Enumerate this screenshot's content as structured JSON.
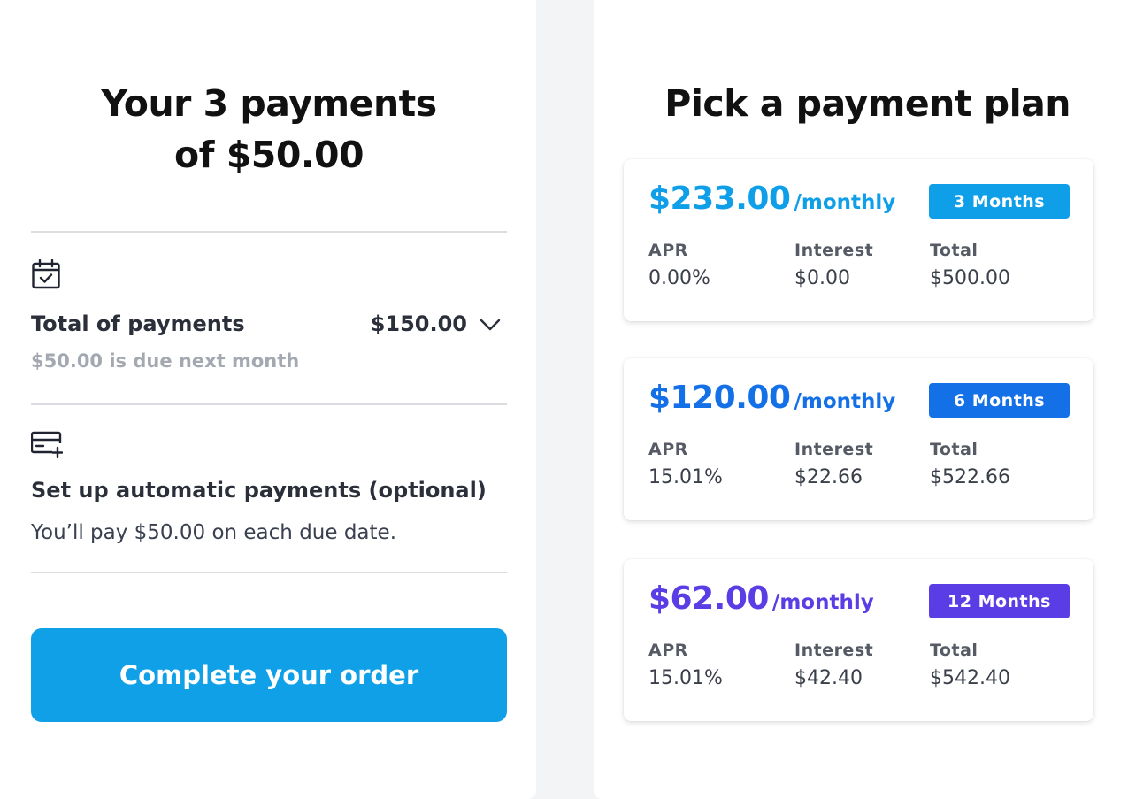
{
  "summary": {
    "title_line1": "Your 3 payments",
    "title_line2": "of $50.00",
    "total_label": "Total of payments",
    "total_amount": "$150.00",
    "due_note": "$50.00 is due next month",
    "autopay_label": "Set up automatic payments (optional)",
    "autopay_note": "You’ll pay $50.00 on each due date.",
    "cta_label": "Complete your order",
    "icons": {
      "calendar": "calendar-check-icon",
      "card": "credit-card-add-icon",
      "dropdown": "chevron-down-icon"
    }
  },
  "plans": {
    "title": "Pick a payment plan",
    "options": [
      {
        "price": "$233.00",
        "period": "/monthly",
        "term": "3 Months",
        "color": "#0f9fe8",
        "apr_label": "APR",
        "apr": "0.00%",
        "interest_label": "Interest",
        "interest": "$0.00",
        "total_label": "Total",
        "total": "$500.00"
      },
      {
        "price": "$120.00",
        "period": "/monthly",
        "term": "6 Months",
        "color": "#1470e6",
        "apr_label": "APR",
        "apr": "15.01%",
        "interest_label": "Interest",
        "interest": "$22.66",
        "total_label": "Total",
        "total": "$522.66"
      },
      {
        "price": "$62.00",
        "period": "/monthly",
        "term": "12 Months",
        "color": "#5b3de6",
        "apr_label": "APR",
        "apr": "15.01%",
        "interest_label": "Interest",
        "interest": "$42.40",
        "total_label": "Total",
        "total": "$542.40"
      }
    ]
  }
}
